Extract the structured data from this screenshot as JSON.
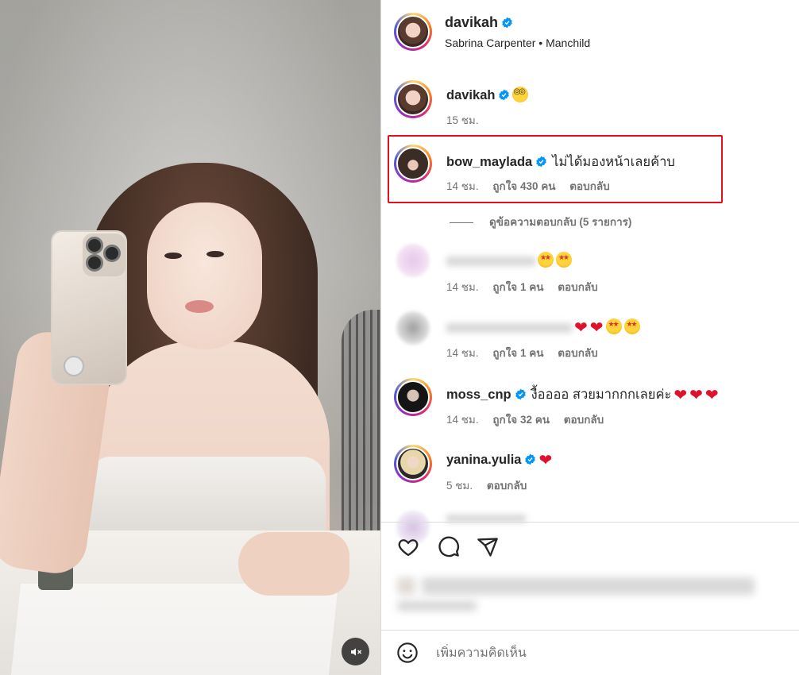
{
  "post": {
    "author": "davikah",
    "audio": "Sabrina Carpenter • Manchild"
  },
  "comments": [
    {
      "username": "davikah",
      "time": "15 ชม."
    },
    {
      "username": "bow_maylada",
      "text": "ไม่ได้มองหน้าเลยค้าบ",
      "time": "14 ชม.",
      "likes": "ถูกใจ 430 คน",
      "reply": "ตอบกลับ"
    },
    {
      "username": "",
      "time": "14 ชม.",
      "likes": "ถูกใจ 1 คน",
      "reply": "ตอบกลับ"
    },
    {
      "username": "",
      "time": "14 ชม.",
      "likes": "ถูกใจ 1 คน",
      "reply": "ตอบกลับ"
    },
    {
      "username": "moss_cnp",
      "text": "งื้ออออ สวยมากกกเลยค่ะ",
      "time": "14 ชม.",
      "likes": "ถูกใจ 32 คน",
      "reply": "ตอบกลับ"
    },
    {
      "username": "yanina.yulia",
      "time": "5 ชม.",
      "reply": "ตอบกลับ"
    }
  ],
  "view_replies": "ดูข้อความตอบกลับ (5 รายการ)",
  "add_comment": {
    "placeholder": "เพิ่มความคิดเห็น"
  },
  "icons": [
    "heart-icon",
    "comment-icon",
    "share-icon",
    "emoji-icon",
    "mute-icon",
    "verified-badge-icon"
  ],
  "colors": {
    "highlight": "#e3101f",
    "verified": "#0095f6",
    "secondary_text": "#737373"
  }
}
